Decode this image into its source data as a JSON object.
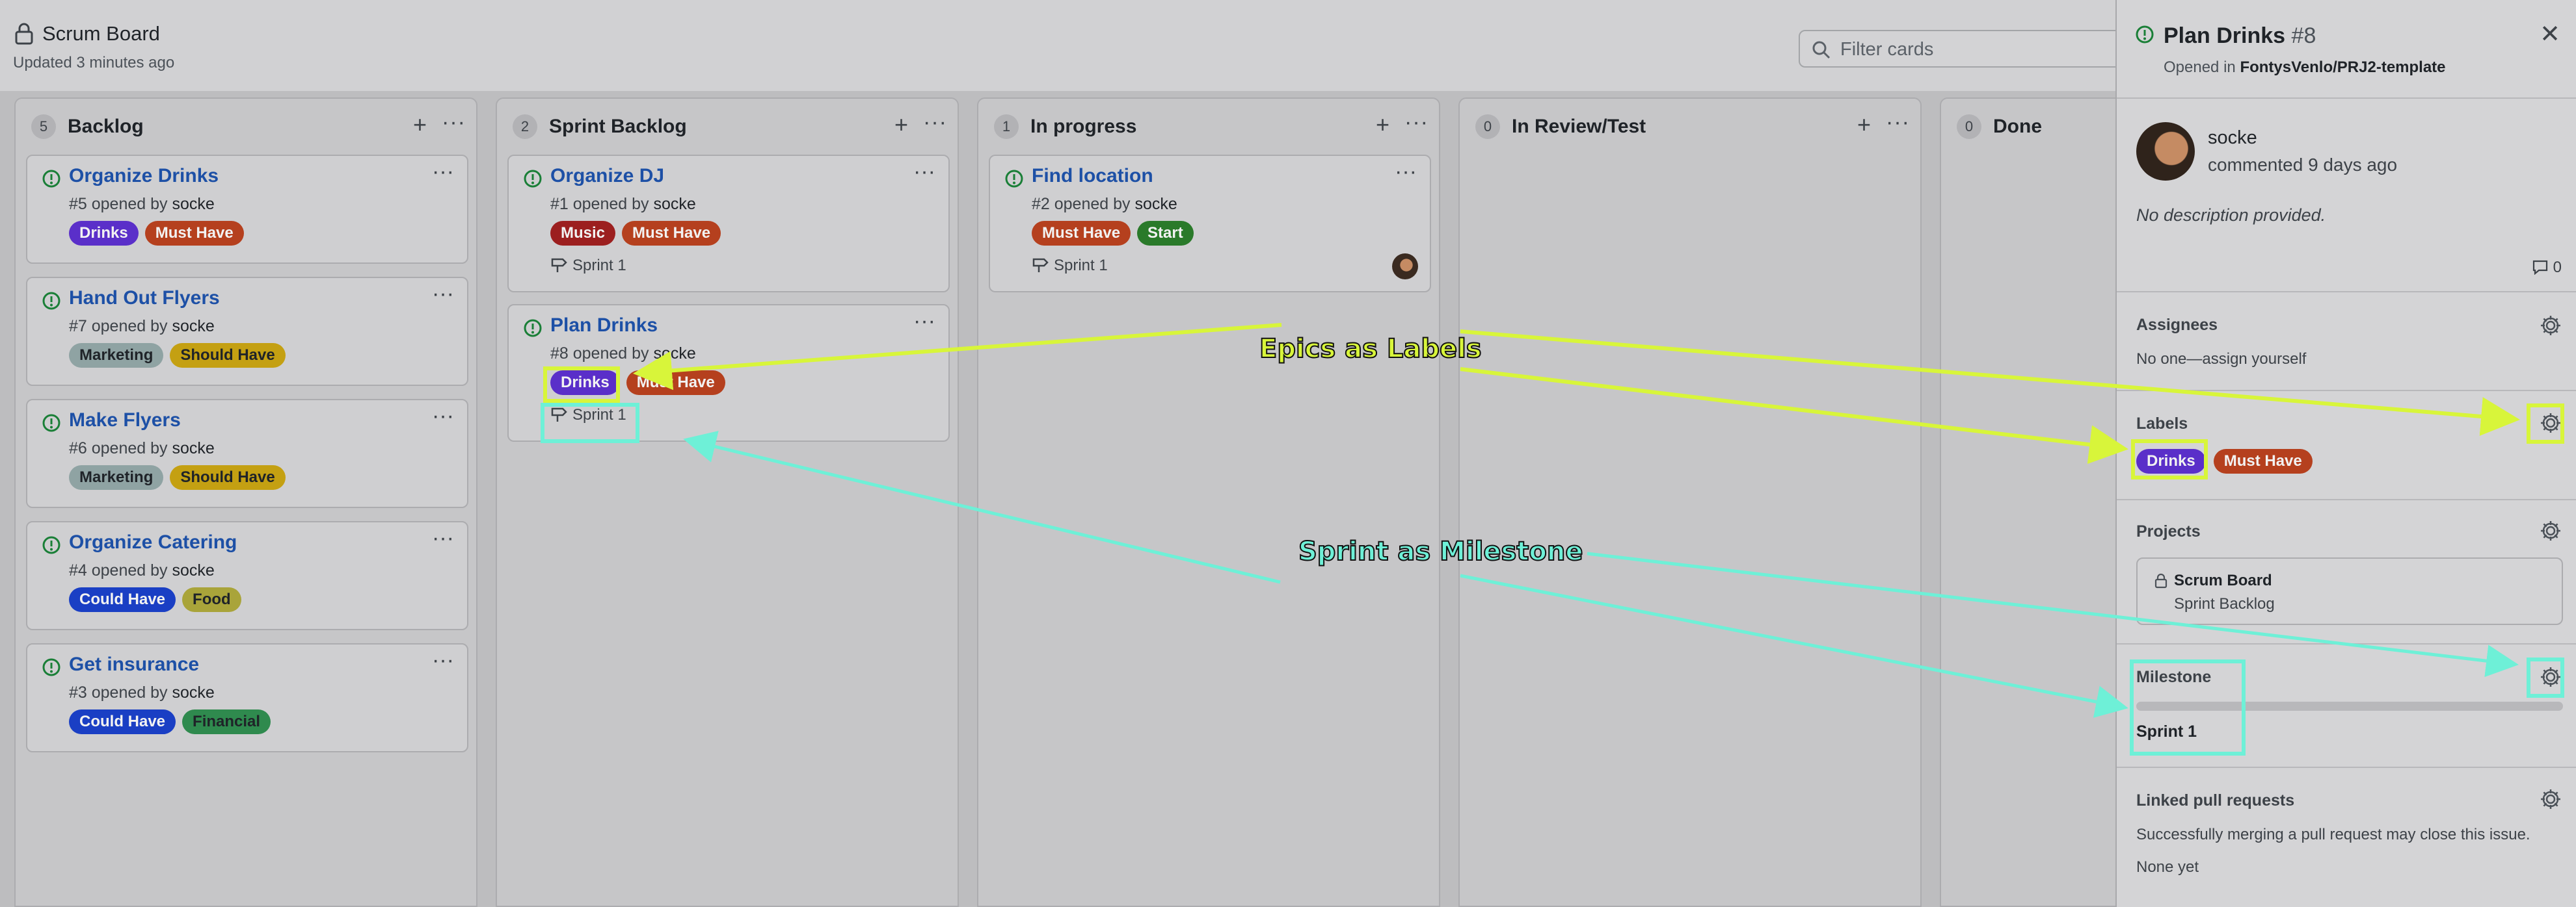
{
  "header": {
    "title": "Scrum Board",
    "updated": "Updated 3 minutes ago",
    "filter_placeholder": "Filter cards"
  },
  "columns": [
    {
      "count": "5",
      "name": "Backlog"
    },
    {
      "count": "2",
      "name": "Sprint Backlog"
    },
    {
      "count": "1",
      "name": "In progress"
    },
    {
      "count": "0",
      "name": "In Review/Test"
    },
    {
      "count": "0",
      "name": "Done"
    }
  ],
  "cards": {
    "organize_drinks": {
      "title": "Organize Drinks",
      "meta": "#5 opened by",
      "author": "socke",
      "labels": [
        "Drinks",
        "Must Have"
      ]
    },
    "hand_out_flyers": {
      "title": "Hand Out Flyers",
      "meta": "#7 opened by",
      "author": "socke",
      "labels": [
        "Marketing",
        "Should Have"
      ]
    },
    "make_flyers": {
      "title": "Make Flyers",
      "meta": "#6 opened by",
      "author": "socke",
      "labels": [
        "Marketing",
        "Should Have"
      ]
    },
    "organize_catering": {
      "title": "Organize Catering",
      "meta": "#4 opened by",
      "author": "socke",
      "labels": [
        "Could Have",
        "Food"
      ]
    },
    "get_insurance": {
      "title": "Get insurance",
      "meta": "#3 opened by",
      "author": "socke",
      "labels": [
        "Could Have",
        "Financial"
      ]
    },
    "organize_dj": {
      "title": "Organize DJ",
      "meta": "#1 opened by",
      "author": "socke",
      "labels": [
        "Music",
        "Must Have"
      ],
      "milestone": "Sprint 1"
    },
    "plan_drinks": {
      "title": "Plan Drinks",
      "meta": "#8 opened by",
      "author": "socke",
      "labels": [
        "Drinks",
        "Must Have"
      ],
      "milestone": "Sprint 1"
    },
    "find_location": {
      "title": "Find location",
      "meta": "#2 opened by",
      "author": "socke",
      "labels": [
        "Must Have",
        "Start"
      ],
      "milestone": "Sprint 1"
    }
  },
  "label_colors": {
    "Drinks": "#5a2fc9",
    "Must Have": "#b5401e",
    "Marketing": "#8fa3a3",
    "Should Have": "#c4a012",
    "Could Have": "#1a3fc4",
    "Food": "#a9a43a",
    "Financial": "#2f8a4e",
    "Music": "#9c1f1f",
    "Start": "#2a7a2a"
  },
  "panel": {
    "title": "Plan Drinks",
    "number": "#8",
    "opened_in": "Opened in",
    "repo": "FontysVenlo/PRJ2-template",
    "comment_author": "socke",
    "comment_time": "commented 9 days ago",
    "description": "No description provided.",
    "comment_count": "0",
    "assignees_title": "Assignees",
    "assignees_text": "No one—assign yourself",
    "labels_title": "Labels",
    "labels": [
      "Drinks",
      "Must Have"
    ],
    "projects_title": "Projects",
    "project_name": "Scrum Board",
    "project_column": "Sprint Backlog",
    "milestone_title": "Milestone",
    "milestone_value": "Sprint 1",
    "linked_title": "Linked pull requests",
    "linked_text": "Successfully merging a pull request may close this issue.",
    "linked_none": "None yet"
  },
  "annotations": {
    "epics": "Epics as Labels",
    "sprint": "Sprint as Milestone",
    "lime": "#d8f53a",
    "cyan": "#6ef0d7"
  }
}
